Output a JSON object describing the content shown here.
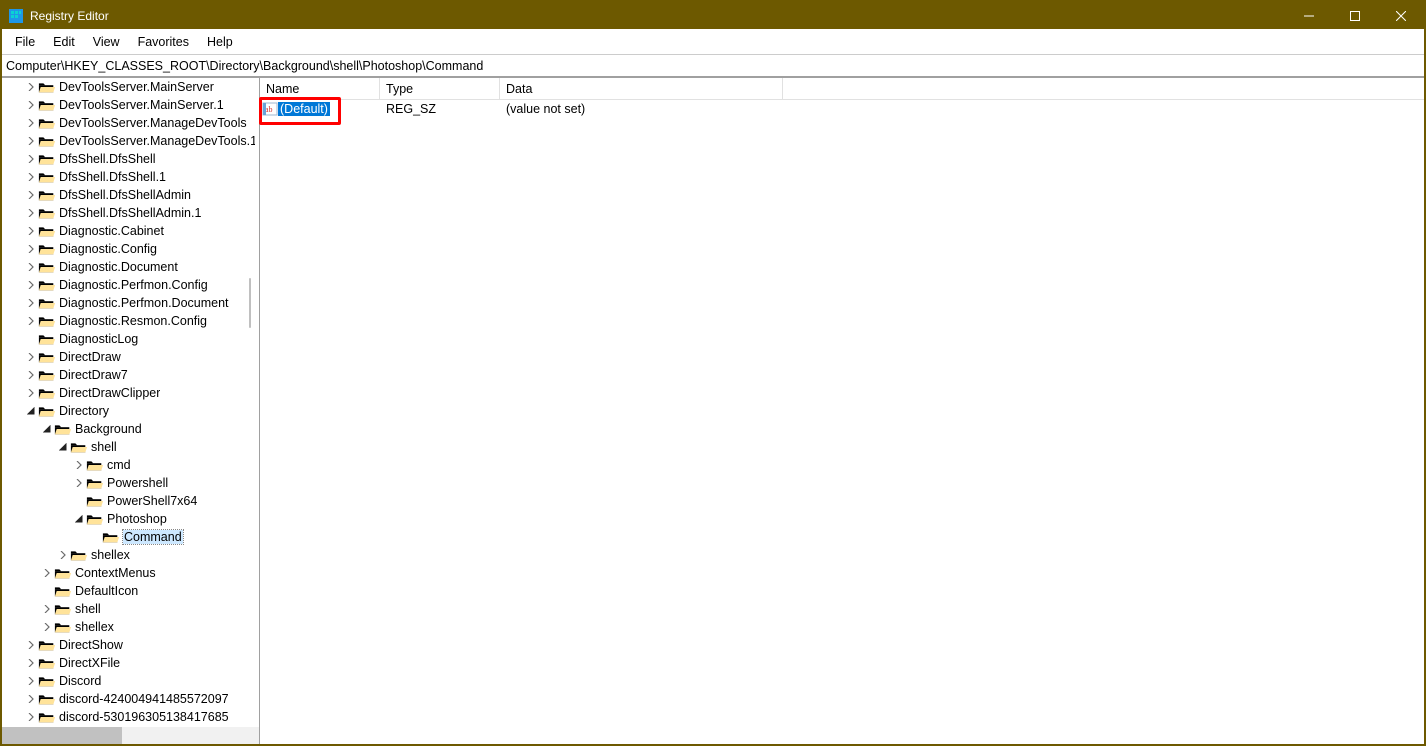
{
  "title": "Registry Editor",
  "menus": [
    "File",
    "Edit",
    "View",
    "Favorites",
    "Help"
  ],
  "address": "Computer\\HKEY_CLASSES_ROOT\\Directory\\Background\\shell\\Photoshop\\Command",
  "columns": {
    "name": "Name",
    "type": "Type",
    "data": "Data"
  },
  "values": [
    {
      "name": "(Default)",
      "type": "REG_SZ",
      "data": "(value not set)",
      "selected": true
    }
  ],
  "tree": [
    {
      "d": 0,
      "exp": "closed",
      "label": "DevToolsServer.MainServer"
    },
    {
      "d": 0,
      "exp": "closed",
      "label": "DevToolsServer.MainServer.1"
    },
    {
      "d": 0,
      "exp": "closed",
      "label": "DevToolsServer.ManageDevTools"
    },
    {
      "d": 0,
      "exp": "closed",
      "label": "DevToolsServer.ManageDevTools.1"
    },
    {
      "d": 0,
      "exp": "closed",
      "label": "DfsShell.DfsShell"
    },
    {
      "d": 0,
      "exp": "closed",
      "label": "DfsShell.DfsShell.1"
    },
    {
      "d": 0,
      "exp": "closed",
      "label": "DfsShell.DfsShellAdmin"
    },
    {
      "d": 0,
      "exp": "closed",
      "label": "DfsShell.DfsShellAdmin.1"
    },
    {
      "d": 0,
      "exp": "closed",
      "label": "Diagnostic.Cabinet"
    },
    {
      "d": 0,
      "exp": "closed",
      "label": "Diagnostic.Config"
    },
    {
      "d": 0,
      "exp": "closed",
      "label": "Diagnostic.Document"
    },
    {
      "d": 0,
      "exp": "closed",
      "label": "Diagnostic.Perfmon.Config"
    },
    {
      "d": 0,
      "exp": "closed",
      "label": "Diagnostic.Perfmon.Document"
    },
    {
      "d": 0,
      "exp": "closed",
      "label": "Diagnostic.Resmon.Config"
    },
    {
      "d": 0,
      "exp": "none",
      "label": "DiagnosticLog"
    },
    {
      "d": 0,
      "exp": "closed",
      "label": "DirectDraw"
    },
    {
      "d": 0,
      "exp": "closed",
      "label": "DirectDraw7"
    },
    {
      "d": 0,
      "exp": "closed",
      "label": "DirectDrawClipper"
    },
    {
      "d": 0,
      "exp": "open",
      "label": "Directory"
    },
    {
      "d": 1,
      "exp": "open",
      "label": "Background"
    },
    {
      "d": 2,
      "exp": "open",
      "label": "shell"
    },
    {
      "d": 3,
      "exp": "closed",
      "label": "cmd"
    },
    {
      "d": 3,
      "exp": "closed",
      "label": "Powershell"
    },
    {
      "d": 3,
      "exp": "none",
      "label": "PowerShell7x64"
    },
    {
      "d": 3,
      "exp": "open",
      "label": "Photoshop"
    },
    {
      "d": 4,
      "exp": "none",
      "label": "Command",
      "selected": true
    },
    {
      "d": 2,
      "exp": "closed",
      "label": "shellex"
    },
    {
      "d": 1,
      "exp": "closed",
      "label": "ContextMenus"
    },
    {
      "d": 1,
      "exp": "none",
      "label": "DefaultIcon"
    },
    {
      "d": 1,
      "exp": "closed",
      "label": "shell"
    },
    {
      "d": 1,
      "exp": "closed",
      "label": "shellex"
    },
    {
      "d": 0,
      "exp": "closed",
      "label": "DirectShow"
    },
    {
      "d": 0,
      "exp": "closed",
      "label": "DirectXFile"
    },
    {
      "d": 0,
      "exp": "closed",
      "label": "Discord"
    },
    {
      "d": 0,
      "exp": "closed",
      "label": "discord-424004941485572097"
    },
    {
      "d": 0,
      "exp": "closed",
      "label": "discord-530196305138417685"
    }
  ]
}
